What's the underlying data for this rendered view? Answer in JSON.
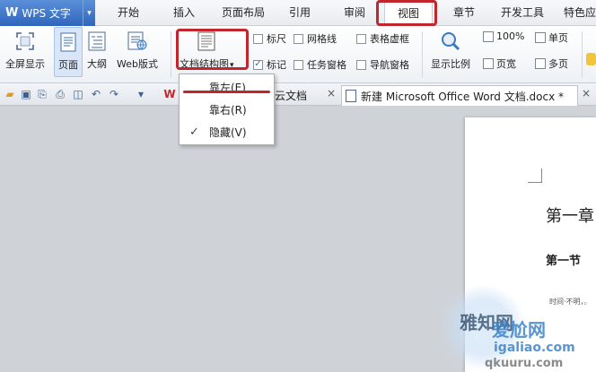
{
  "app": {
    "logo": "W",
    "name": "WPS 文字",
    "caret": "▾"
  },
  "menu": {
    "tabs": [
      {
        "label": "开始"
      },
      {
        "label": "插入"
      },
      {
        "label": "页面布局"
      },
      {
        "label": "引用"
      },
      {
        "label": "审阅"
      },
      {
        "label": "视图"
      },
      {
        "label": "章节"
      },
      {
        "label": "开发工具"
      },
      {
        "label": "特色应"
      }
    ],
    "active": "视图"
  },
  "ribbon": {
    "fullscreen": "全屏显示",
    "page_view": "页面",
    "outline": "大纲",
    "web": "Web版式",
    "doc_map": "文档结构图",
    "doc_map_caret": "▾",
    "ruler": "标尺",
    "gridlines": "网格线",
    "table_grid": "表格虚框",
    "marks": "标记",
    "task_pane": "任务窗格",
    "nav_pane": "导航窗格",
    "zoom_ratio": "显示比例",
    "zoom_100": "100%",
    "single_page": "单页",
    "page_width": "页宽",
    "multi_page": "多页",
    "check_mark": "✓"
  },
  "doc_tabs": [
    {
      "label": "云文档",
      "close": "×"
    },
    {
      "label": "新建 Microsoft Office Word 文档.docx *",
      "close": "×"
    }
  ],
  "doc_tab_prefix": "W",
  "dropdown": {
    "items": [
      {
        "label": "靠左(E)"
      },
      {
        "label": "靠右(R)"
      },
      {
        "label": "隐藏(V)",
        "checked": true
      }
    ],
    "check": "✓"
  },
  "document": {
    "heading1": "第一章",
    "heading2": "第一节",
    "tiny_text": "时间·不明，",
    "tiny_text_hl": "。"
  },
  "watermark": {
    "a": "雅知网",
    "b": "爱尬网",
    "c": "igaliao.com",
    "d": "qkuuru.com"
  },
  "colors": {
    "highlight_red": "#c0272d",
    "app_blue": "#2f66bd"
  }
}
